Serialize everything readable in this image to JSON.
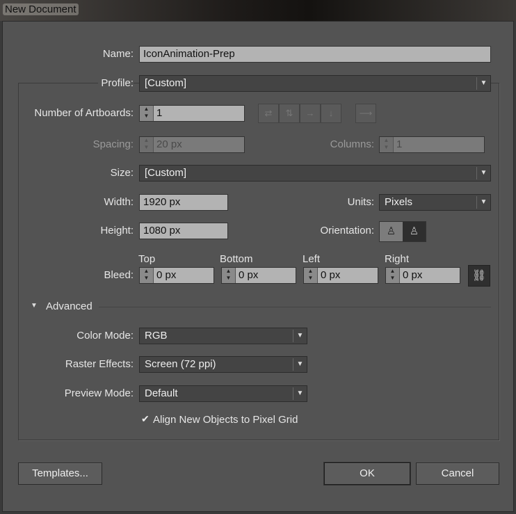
{
  "title": "New Document",
  "name": {
    "label": "Name:",
    "value": "IconAnimation-Prep"
  },
  "profile": {
    "label": "Profile:",
    "value": "[Custom]"
  },
  "artboards": {
    "label": "Number of Artboards:",
    "value": "1"
  },
  "spacing": {
    "label": "Spacing:",
    "value": "20 px"
  },
  "columns": {
    "label": "Columns:",
    "value": "1"
  },
  "size": {
    "label": "Size:",
    "value": "[Custom]"
  },
  "width": {
    "label": "Width:",
    "value": "1920 px"
  },
  "height": {
    "label": "Height:",
    "value": "1080 px"
  },
  "units": {
    "label": "Units:",
    "value": "Pixels"
  },
  "orientation": {
    "label": "Orientation:"
  },
  "bleed": {
    "label": "Bleed:",
    "top_label": "Top",
    "bottom_label": "Bottom",
    "left_label": "Left",
    "right_label": "Right",
    "top": "0 px",
    "bottom": "0 px",
    "left": "0 px",
    "right": "0 px"
  },
  "advanced": {
    "label": "Advanced",
    "color_mode": {
      "label": "Color Mode:",
      "value": "RGB"
    },
    "raster": {
      "label": "Raster Effects:",
      "value": "Screen (72 ppi)"
    },
    "preview": {
      "label": "Preview Mode:",
      "value": "Default"
    },
    "align": {
      "label": "Align New Objects to Pixel Grid",
      "checked": true
    }
  },
  "buttons": {
    "templates": "Templates...",
    "ok": "OK",
    "cancel": "Cancel"
  }
}
